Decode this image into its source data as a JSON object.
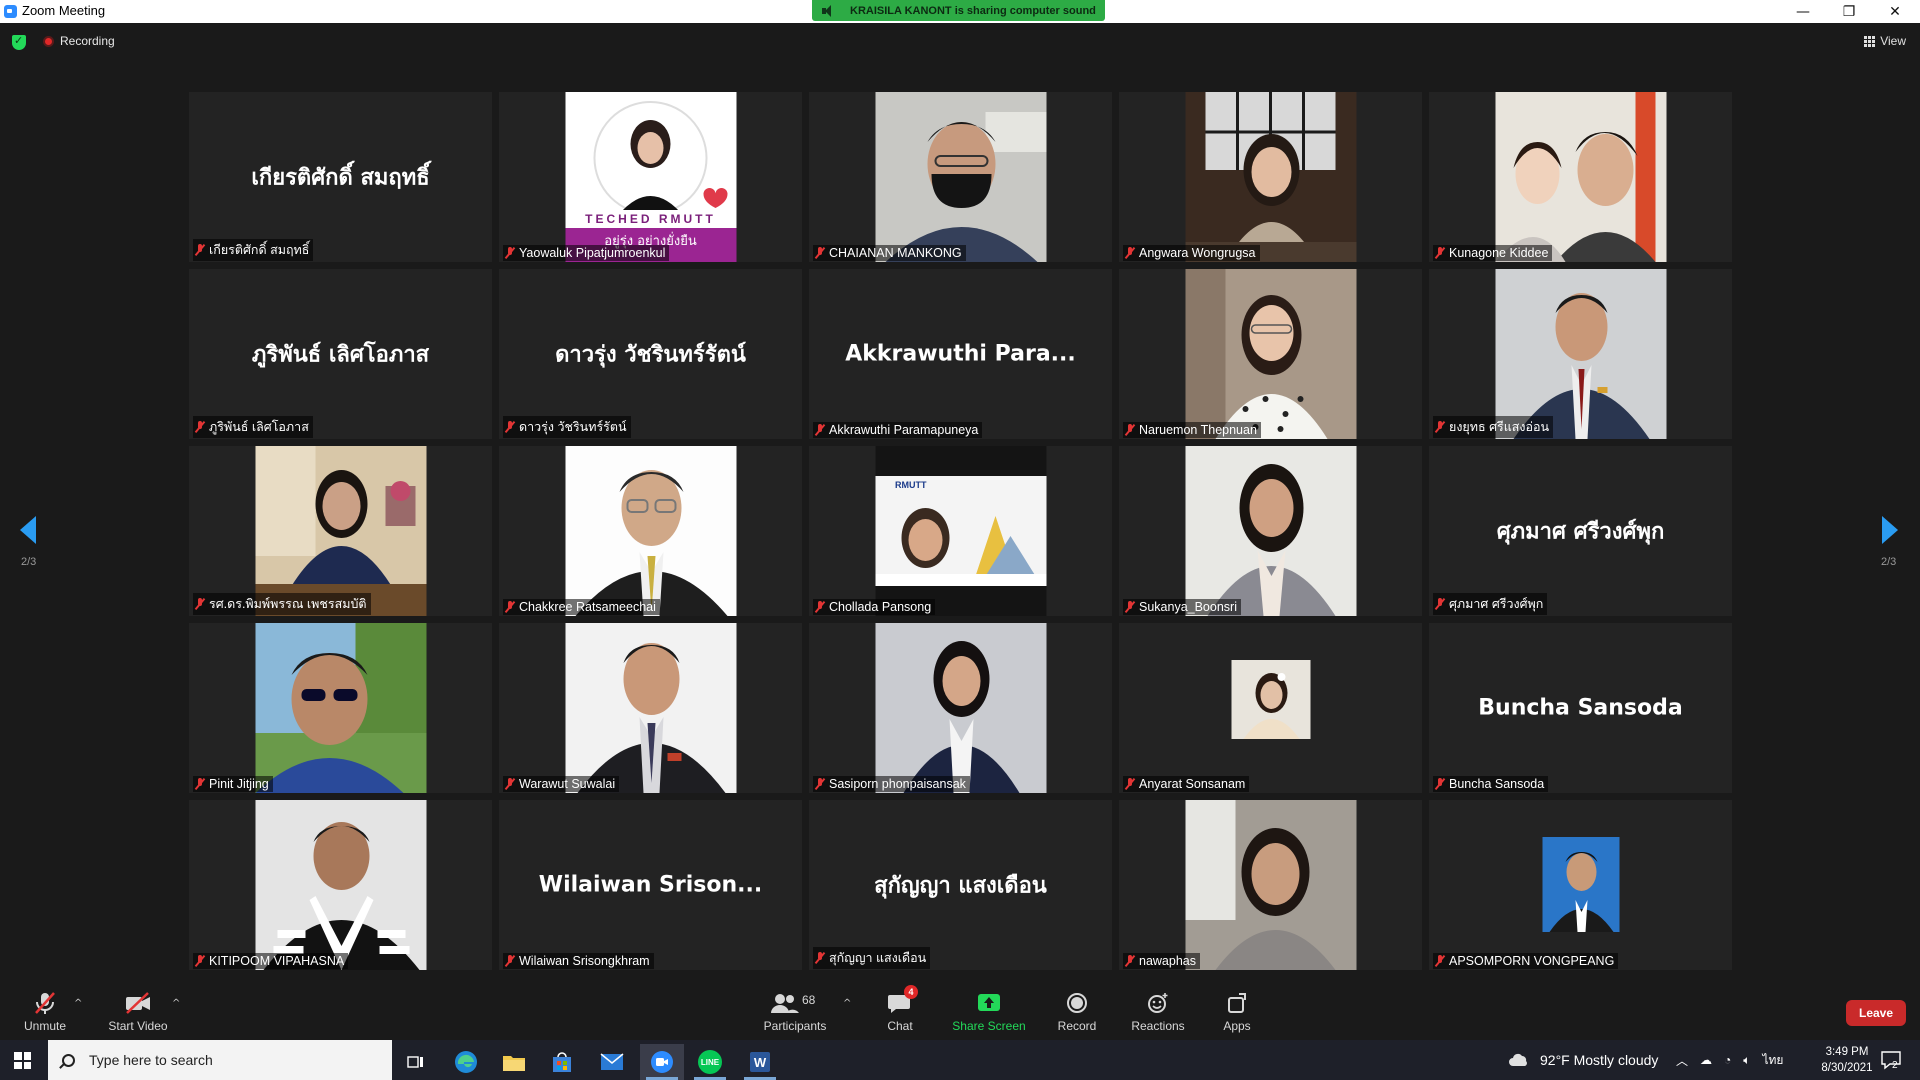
{
  "window": {
    "title": "Zoom Meeting",
    "share_banner": "KRAISILA KANONT is sharing computer sound",
    "recording_label": "Recording",
    "view_label": "View",
    "page_indicator_left": "2/3",
    "page_indicator_right": "2/3"
  },
  "participants": [
    {
      "display": "เกียรติศักดิ์ สมฤทธิ์",
      "label": "เกียรติศักดิ์ สมฤทธิ์",
      "video": false
    },
    {
      "display": "",
      "label": "Yaowaluk Pipatjumroenkul",
      "video": true,
      "photo": "teched-badge",
      "photo_text": "TECHED RMUTT",
      "photo_subtext": "อยู่รุ่ง อย่างยั่งยืน"
    },
    {
      "display": "",
      "label": "CHAIANAN MANKONG",
      "video": true,
      "photo": "man-mask"
    },
    {
      "display": "",
      "label": "Angwara Wongrugsa",
      "video": true,
      "photo": "woman-window"
    },
    {
      "display": "",
      "label": "Kunagone Kiddee",
      "video": true,
      "photo": "selfie"
    },
    {
      "display": "ภูริพันธ์ เลิศโอภาส",
      "label": "ภูริพันธ์ เลิศโอภาส",
      "video": false
    },
    {
      "display": "ดาวรุ่ง วัชรินทร์รัตน์",
      "label": "ดาวรุ่ง วัชรินทร์รัตน์",
      "video": false
    },
    {
      "display": "Akkrawuthi  Para...",
      "label": "Akkrawuthi Paramapuneya",
      "video": false
    },
    {
      "display": "",
      "label": "Naruemon Thepnuan",
      "video": true,
      "photo": "woman-office"
    },
    {
      "display": "",
      "label": "ยงยุทธ ศรีแสงอ่อน",
      "video": true,
      "photo": "man-suit-gray"
    },
    {
      "display": "",
      "label": "รศ.ดร.พิมพ์พรรณ เพชรสมบัติ",
      "video": true,
      "photo": "woman-desk"
    },
    {
      "display": "",
      "label": "Chakkree Ratsameechai",
      "video": true,
      "photo": "man-glasses-white"
    },
    {
      "display": "",
      "label": "Chollada Pansong",
      "video": true,
      "photo": "poster",
      "photo_text": "RMUTT"
    },
    {
      "display": "",
      "label": "Sukanya_Boonsri",
      "video": true,
      "photo": "woman-blazer"
    },
    {
      "display": "ศุภมาศ ศรีวงศ์พุก",
      "label": "ศุภมาศ ศรีวงศ์พุก",
      "video": false
    },
    {
      "display": "",
      "label": "Pinit Jitjing",
      "video": true,
      "photo": "man-sunglasses"
    },
    {
      "display": "",
      "label": "Warawut Suwalai",
      "video": true,
      "photo": "man-dark-suit"
    },
    {
      "display": "",
      "label": "Sasiporn phonpaisansak",
      "video": true,
      "photo": "woman-navy"
    },
    {
      "display": "",
      "label": "Anyarat Sonsanam",
      "video": true,
      "photo": "small-portrait"
    },
    {
      "display": "Buncha Sansoda",
      "label": "Buncha Sansoda",
      "video": false
    },
    {
      "display": "",
      "label": "KITIPOOM VIPAHASNA",
      "video": true,
      "photo": "graduation"
    },
    {
      "display": "Wilaiwan  Srison...",
      "label": "Wilaiwan Srisongkhram",
      "video": false
    },
    {
      "display": "สุกัญญา  แสงเดือน",
      "label": "สุกัญญา  แสงเดือน",
      "video": false
    },
    {
      "display": "",
      "label": "nawaphas",
      "video": true,
      "photo": "woman-home"
    },
    {
      "display": "",
      "label": "APSOMPORN VONGPEANG",
      "video": true,
      "photo": "id-photo"
    }
  ],
  "toolbar": {
    "unmute": "Unmute",
    "start_video": "Start Video",
    "participants": "Participants",
    "participants_count": "68",
    "chat": "Chat",
    "chat_badge": "4",
    "share_screen": "Share Screen",
    "record": "Record",
    "reactions": "Reactions",
    "apps": "Apps",
    "leave": "Leave"
  },
  "taskbar": {
    "search_placeholder": "Type here to search",
    "weather": "92°F  Mostly cloudy",
    "language": "ไทย",
    "time": "3:49 PM",
    "date": "8/30/2021",
    "notification_count": "2"
  },
  "colors": {
    "share_green": "#2dab45",
    "leave_red": "#c92a2a",
    "nav_blue": "#2a9cf2",
    "share_screen_green": "#23d959"
  }
}
